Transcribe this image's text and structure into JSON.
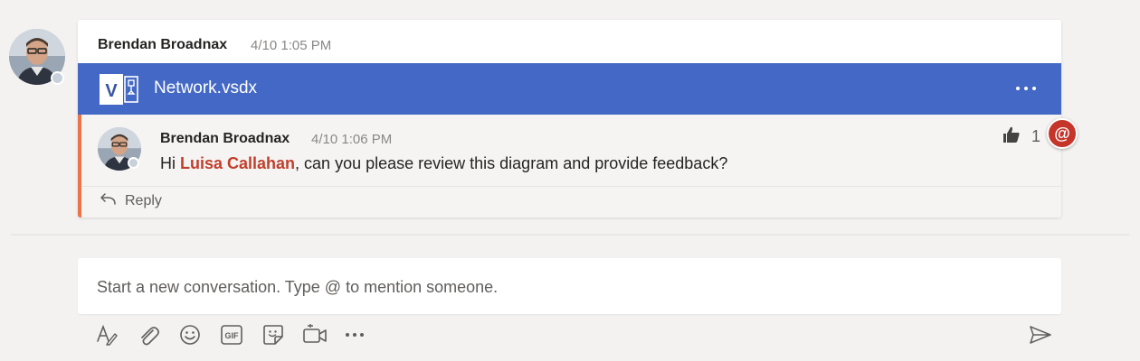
{
  "thread": {
    "author": "Brendan Broadnax",
    "timestamp": "4/10 1:05 PM"
  },
  "attachment": {
    "file_name": "Network.vsdx",
    "app_icon": "visio-icon",
    "bar_color": "#4468c5"
  },
  "reply": {
    "author": "Brendan Broadnax",
    "timestamp": "4/10 1:06 PM",
    "body_before": "Hi ",
    "mention": "Luisa Callahan",
    "body_after": ", can you please review this diagram and provide feedback?",
    "accent_color": "#e97548",
    "like_count": "1",
    "mention_badge": "@"
  },
  "actions": {
    "reply_label": "Reply"
  },
  "compose": {
    "placeholder": "Start a new conversation. Type @ to mention someone."
  },
  "toolbar": {
    "icons": [
      "format-icon",
      "attach-icon",
      "emoji-icon",
      "gif-icon",
      "sticker-icon",
      "meet-now-icon",
      "more-icon"
    ],
    "send_icon": "send-icon"
  },
  "colors": {
    "mention": "#c23e2b",
    "badge": "#c6352a"
  }
}
